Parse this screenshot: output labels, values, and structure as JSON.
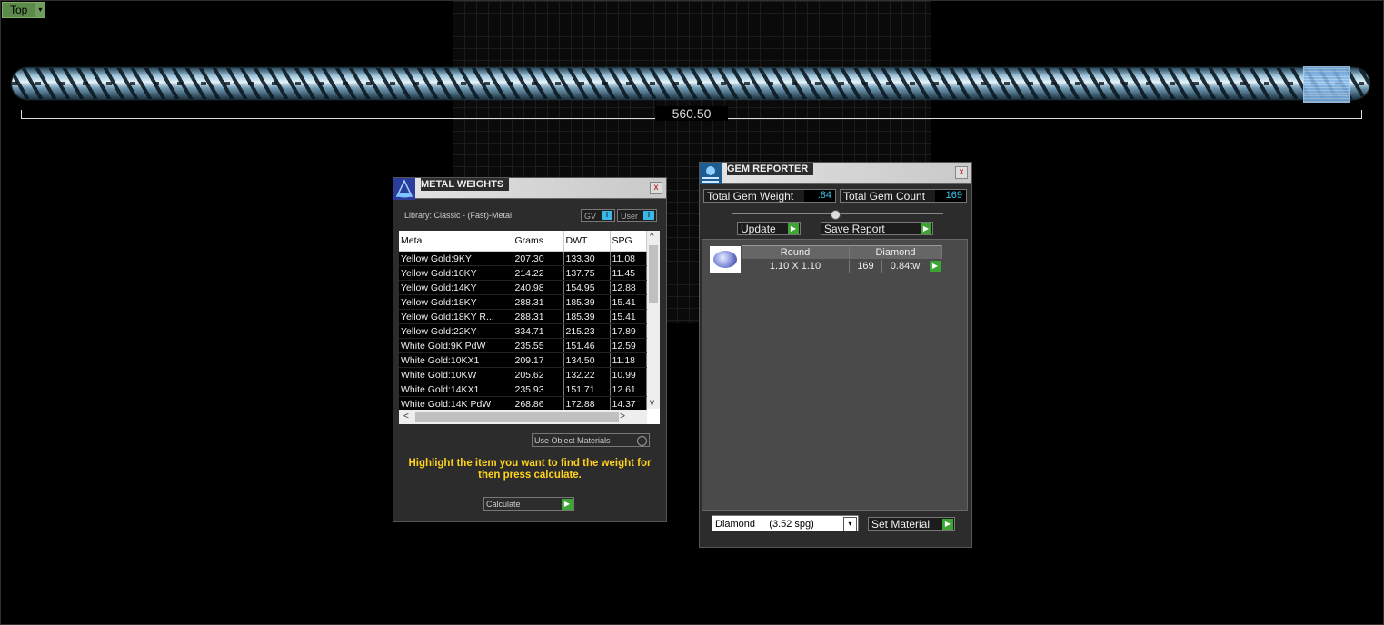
{
  "viewport": {
    "label": "Top",
    "dimension": "560.50"
  },
  "metal_weights": {
    "title": "METAL WEIGHTS",
    "library": "Library: Classic - (Fast)-Metal",
    "toggle_gv": "GV",
    "toggle_user": "User",
    "toggle_state": "I",
    "columns": [
      "Metal",
      "Grams",
      "DWT",
      "SPG"
    ],
    "rows": [
      [
        "Yellow Gold:9KY",
        "207.30",
        "133.30",
        "11.08"
      ],
      [
        "Yellow Gold:10KY",
        "214.22",
        "137.75",
        "11.45"
      ],
      [
        "Yellow Gold:14KY",
        "240.98",
        "154.95",
        "12.88"
      ],
      [
        "Yellow Gold:18KY",
        "288.31",
        "185.39",
        "15.41"
      ],
      [
        "Yellow Gold:18KY R...",
        "288.31",
        "185.39",
        "15.41"
      ],
      [
        "Yellow Gold:22KY",
        "334.71",
        "215.23",
        "17.89"
      ],
      [
        "White Gold:9K PdW",
        "235.55",
        "151.46",
        "12.59"
      ],
      [
        "White Gold:10KX1",
        "209.17",
        "134.50",
        "11.18"
      ],
      [
        "White Gold:10KW",
        "205.62",
        "132.22",
        "10.99"
      ],
      [
        "White Gold:14KX1",
        "235.93",
        "151.71",
        "12.61"
      ],
      [
        "White Gold:14K PdW",
        "268.86",
        "172.88",
        "14.37"
      ]
    ],
    "use_object_materials": "Use Object Materials",
    "hint": "Highlight the item you want to find the weight for then press calculate.",
    "calculate": "Calculate"
  },
  "gem_reporter": {
    "title": "GEM REPORTER",
    "total_weight_label": "Total Gem Weight",
    "total_weight_value": ".84",
    "total_count_label": "Total Gem Count",
    "total_count_value": "169",
    "update": "Update",
    "save_report": "Save Report",
    "gem": {
      "shape": "Round",
      "material": "Diamond",
      "size": "1.10 X 1.10",
      "count": "169",
      "weight": "0.84tw"
    },
    "material_select": "Diamond     (3.52 spg)",
    "set_material": "Set Material"
  },
  "icons": {
    "dropdown": "▾",
    "close": "x",
    "go": "▶",
    "scroll_up": "^",
    "scroll_down": "v",
    "scroll_left": "<",
    "scroll_right": ">"
  }
}
